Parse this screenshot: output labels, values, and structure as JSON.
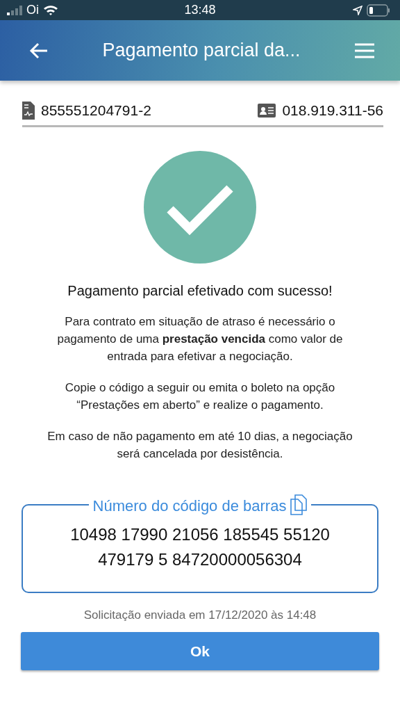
{
  "status_bar": {
    "carrier": "Oi",
    "time": "13:48"
  },
  "header": {
    "title": "Pagamento parcial da..."
  },
  "info": {
    "contract": "855551204791-2",
    "document": "018.919.311-56"
  },
  "success": {
    "title": "Pagamento parcial efetivado com sucesso!"
  },
  "paragraphs": [
    "Para contrato em situação de atraso é necessário o pagamento de uma **prestação vencida** como valor de entrada para efetivar a negociação.",
    "Copie o código a seguir ou emita o boleto na opção “Prestações em aberto” e realize o pagamento.",
    "Em caso de não pagamento em até 10 dias, a negociação será cancelada por desistência."
  ],
  "barcode": {
    "label": "Número do código de barras",
    "lines": [
      "10498 17990 21056 185545 55120",
      "479179 5 84720000056304"
    ]
  },
  "sent_note": "Solicitação enviada em 17/12/2020 às 14:48",
  "button": "Ok"
}
